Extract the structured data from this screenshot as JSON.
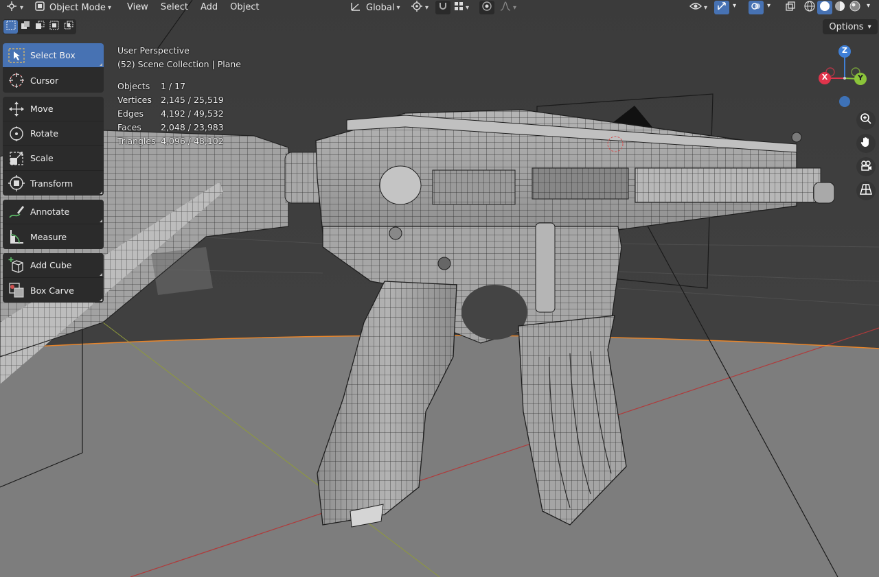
{
  "header": {
    "mode": "Object Mode",
    "menus": [
      "View",
      "Select",
      "Add",
      "Object"
    ],
    "transform_orientation": "Global",
    "options_label": "Options"
  },
  "toolbar": {
    "groups": [
      [
        {
          "label": "Select Box",
          "icon": "select-box-icon",
          "active": true
        },
        {
          "label": "Cursor",
          "icon": "cursor-icon"
        }
      ],
      [
        {
          "label": "Move",
          "icon": "move-icon"
        },
        {
          "label": "Rotate",
          "icon": "rotate-icon"
        },
        {
          "label": "Scale",
          "icon": "scale-icon"
        },
        {
          "label": "Transform",
          "icon": "transform-icon"
        }
      ],
      [
        {
          "label": "Annotate",
          "icon": "annotate-icon"
        },
        {
          "label": "Measure",
          "icon": "measure-icon"
        }
      ],
      [
        {
          "label": "Add Cube",
          "icon": "add-cube-icon"
        },
        {
          "label": "Box Carve",
          "icon": "box-carve-icon"
        }
      ]
    ]
  },
  "overlay": {
    "view_name": "User Perspective",
    "collection": "(52) Scene Collection | Plane",
    "stats": [
      {
        "label": "Objects",
        "value": "1 / 17"
      },
      {
        "label": "Vertices",
        "value": "2,145 / 25,519"
      },
      {
        "label": "Edges",
        "value": "4,192 / 49,532"
      },
      {
        "label": "Faces",
        "value": "2,048 / 23,983"
      },
      {
        "label": "Triangles",
        "value": "4,096 / 48,102"
      }
    ]
  },
  "gizmo": {
    "axes": {
      "x": "X",
      "y": "Y",
      "z": "Z"
    },
    "colors": {
      "x": "#e0344b",
      "y": "#8bc43a",
      "z": "#3f7fd6"
    }
  },
  "colors": {
    "accent": "#4772b3",
    "horizon": "#e8852a",
    "panel": "#2b2b2b"
  }
}
